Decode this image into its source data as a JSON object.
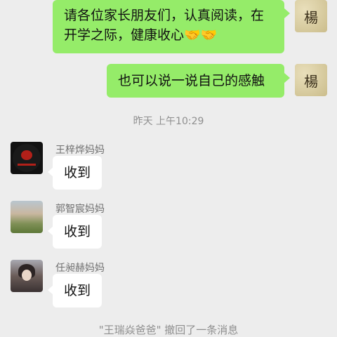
{
  "messages": [
    {
      "side": "right",
      "lines": [
        "请各位家长朋友们，认真阅读，在",
        "开学之际，健康收心🤝🤝"
      ],
      "avatar_text": "楊"
    },
    {
      "side": "right",
      "lines": [
        "也可以说一说自己的感触"
      ],
      "avatar_text": "楊"
    }
  ],
  "timestamp": "昨天 上午10:29",
  "replies": [
    {
      "name": "王梓烨妈妈",
      "text": "收到",
      "avatar": "logo-avatar"
    },
    {
      "name": "郭智宸妈妈",
      "text": "收到",
      "avatar": "landscape-avatar"
    },
    {
      "name": "任昶赫妈妈",
      "text": "收到",
      "avatar": "portrait-avatar"
    }
  ],
  "recall_notice": "\"王瑞焱爸爸\" 撤回了一条消息",
  "colors": {
    "background": "#ededed",
    "sent_bubble": "#95ec69",
    "received_bubble": "#ffffff"
  }
}
